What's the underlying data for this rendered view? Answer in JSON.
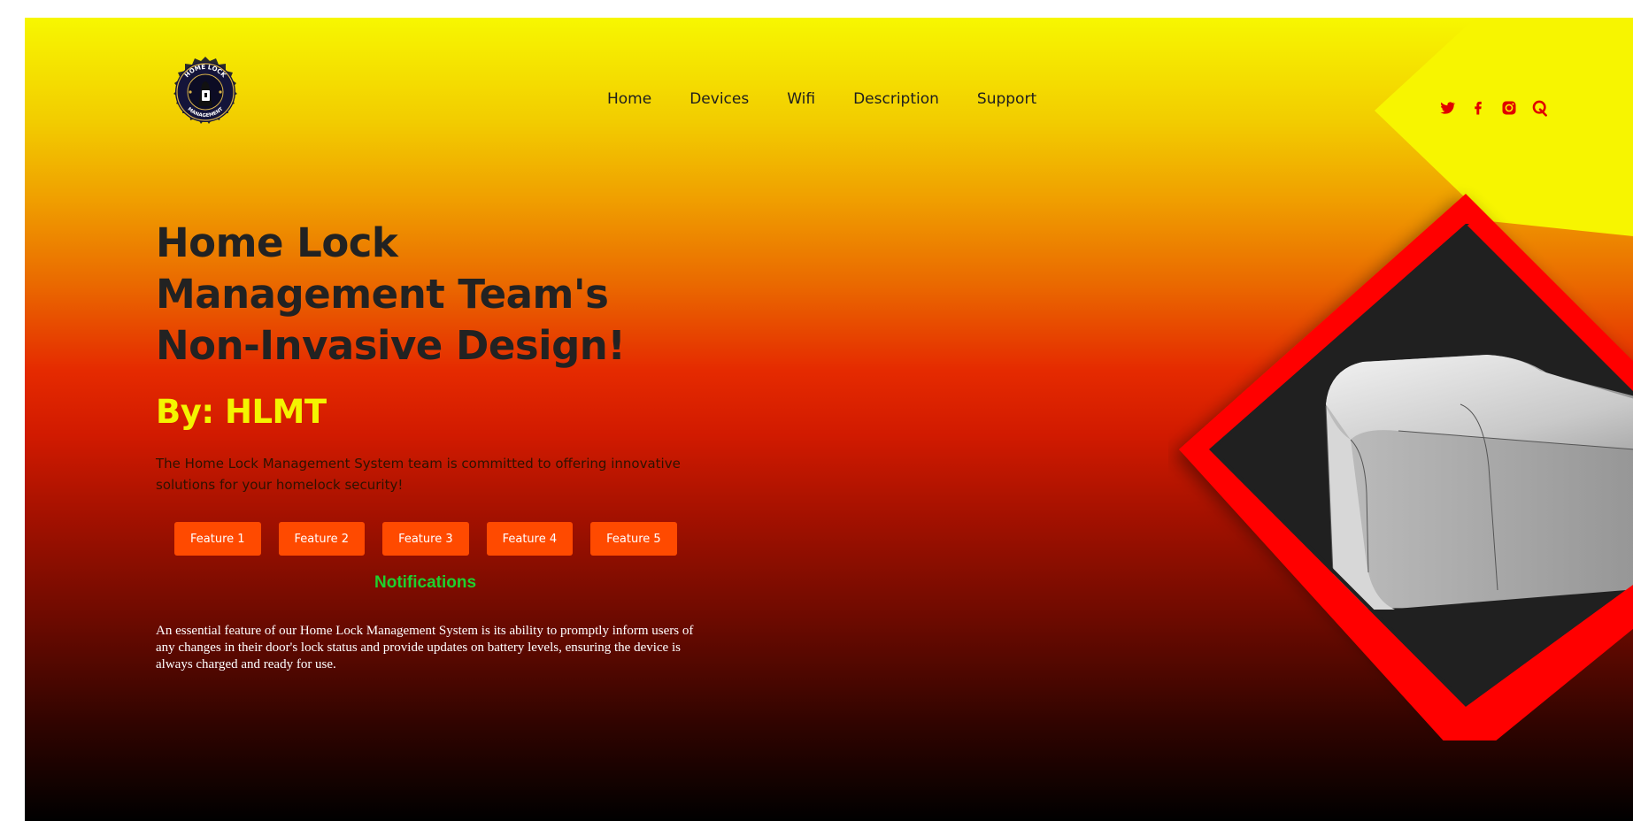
{
  "brand": {
    "logo_alt": "Home Lock Management",
    "logo_text_top": "HOME LOCK",
    "logo_text_bottom": "MANAGEMENT"
  },
  "nav": {
    "items": [
      {
        "label": "Home"
      },
      {
        "label": "Devices"
      },
      {
        "label": "Wifi"
      },
      {
        "label": "Description"
      },
      {
        "label": "Support"
      }
    ]
  },
  "social": {
    "icons": [
      "twitter-icon",
      "facebook-icon",
      "instagram-icon",
      "quora-icon"
    ],
    "icon_color": "#e00000"
  },
  "hero": {
    "title_line1": "Home Lock",
    "title_line2": "Management Team's",
    "title_line3": "Non-Invasive Design!",
    "subtitle": "By: HLMT",
    "description": "The Home Lock Management System team is committed to offering innovative solutions for your homelock security!"
  },
  "features": [
    {
      "label": "Feature 1"
    },
    {
      "label": "Feature 2"
    },
    {
      "label": "Feature 3"
    },
    {
      "label": "Feature 4"
    },
    {
      "label": "Feature 5"
    }
  ],
  "notifications": {
    "title": "Notifications",
    "text": "An essential feature of our Home Lock Management System is its ability to promptly inform users of any changes in their door's lock status and provide updates on battery levels, ensuring the device is always charged and ready for use."
  },
  "colors": {
    "accent": "#ff4a00",
    "subtitle": "#f4f400",
    "notifications_title": "#1fd02e",
    "diamond_border": "#ff0000",
    "diamond_inner": "#202020"
  }
}
